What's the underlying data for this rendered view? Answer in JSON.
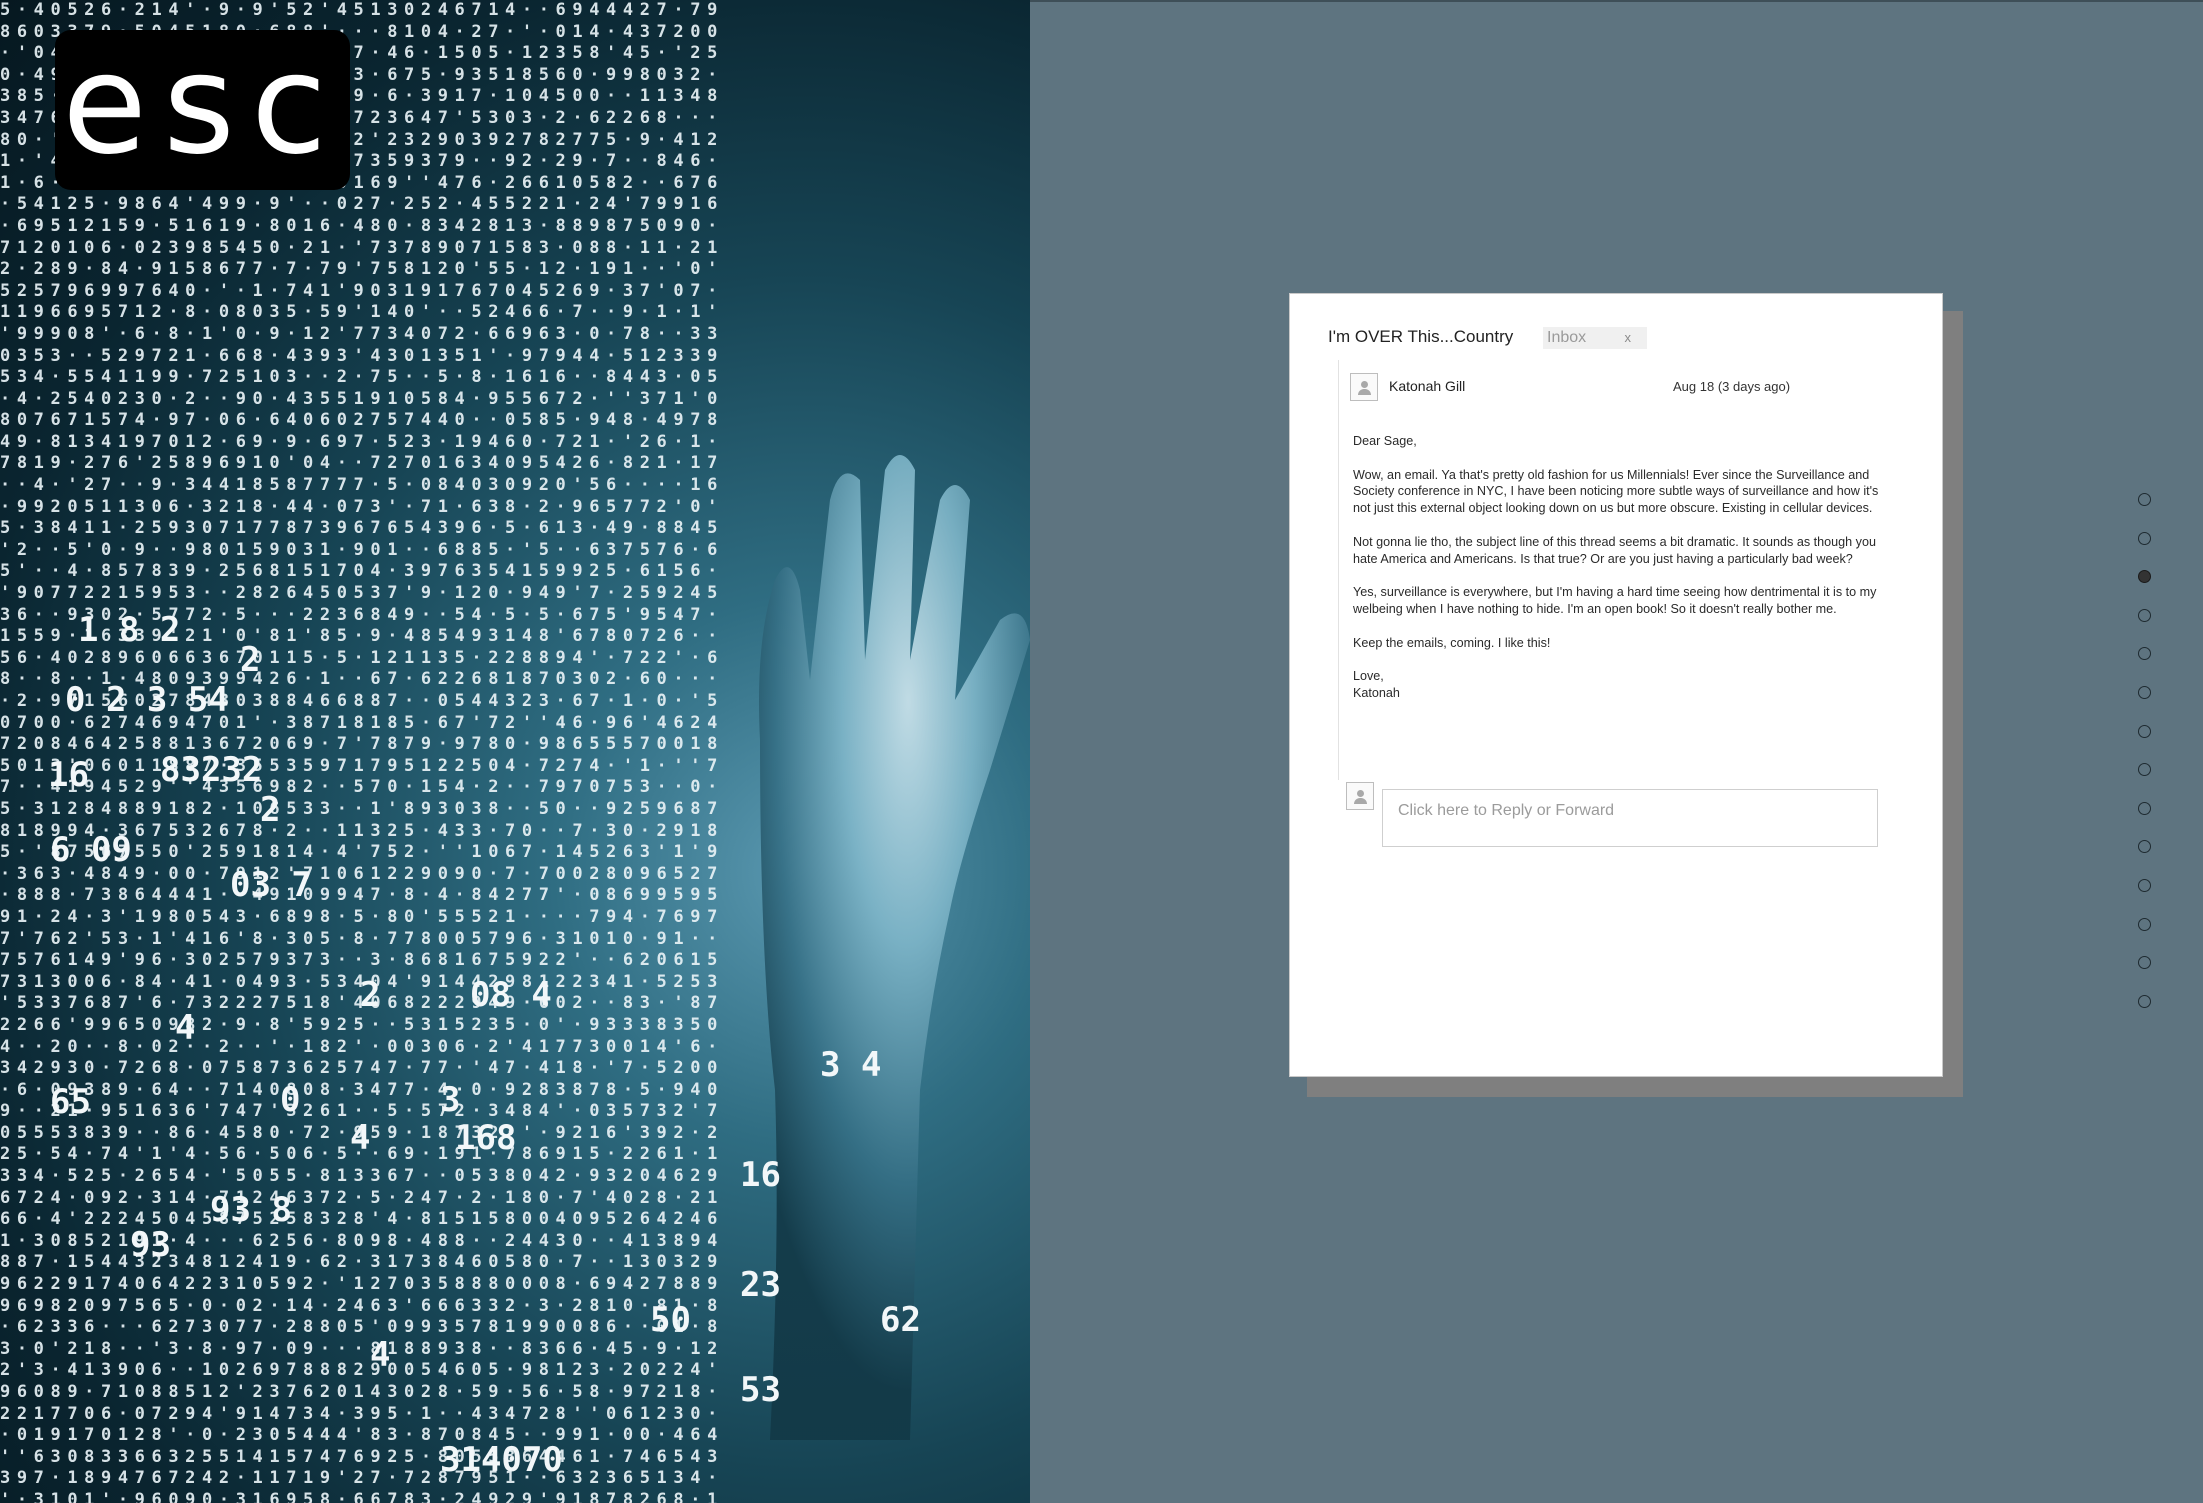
{
  "esc_button": {
    "label": "esc"
  },
  "email": {
    "subject": "I'm OVER This...Country",
    "tag": {
      "label": "Inbox",
      "remove": "x"
    },
    "sender": "Katonah Gill",
    "date": "Aug 18 (3 days ago)",
    "body": [
      "Dear Sage,",
      "Wow, an email. Ya that's pretty old fashion for us Millennials! Ever since the Surveillance and Society conference in NYC, I have been noticing more subtle ways of surveillance and how it's not just this external object looking down on us but more obscure. Existing in cellular devices.",
      "Not gonna lie tho, the subject line of this thread seems a bit dramatic. It sounds as though you hate America and Americans. Is that true? Or are you just having a particularly bad week?",
      "Yes, surveillance is everywhere, but I'm having a hard time seeing how dentrimental it is to my welbeing when I have nothing to hide. I'm an open book! So it doesn't really bother me.",
      "Keep the emails, coming. I like this!"
    ],
    "signoff": "Love,",
    "signature": "Katonah",
    "reply_placeholder": "Click here to Reply or Forward"
  },
  "pager": {
    "total": 14,
    "active_index": 2
  },
  "colors": {
    "page_background": "#5e7480",
    "card_shadow": "#7f7f7f",
    "esc_background": "#000000"
  }
}
